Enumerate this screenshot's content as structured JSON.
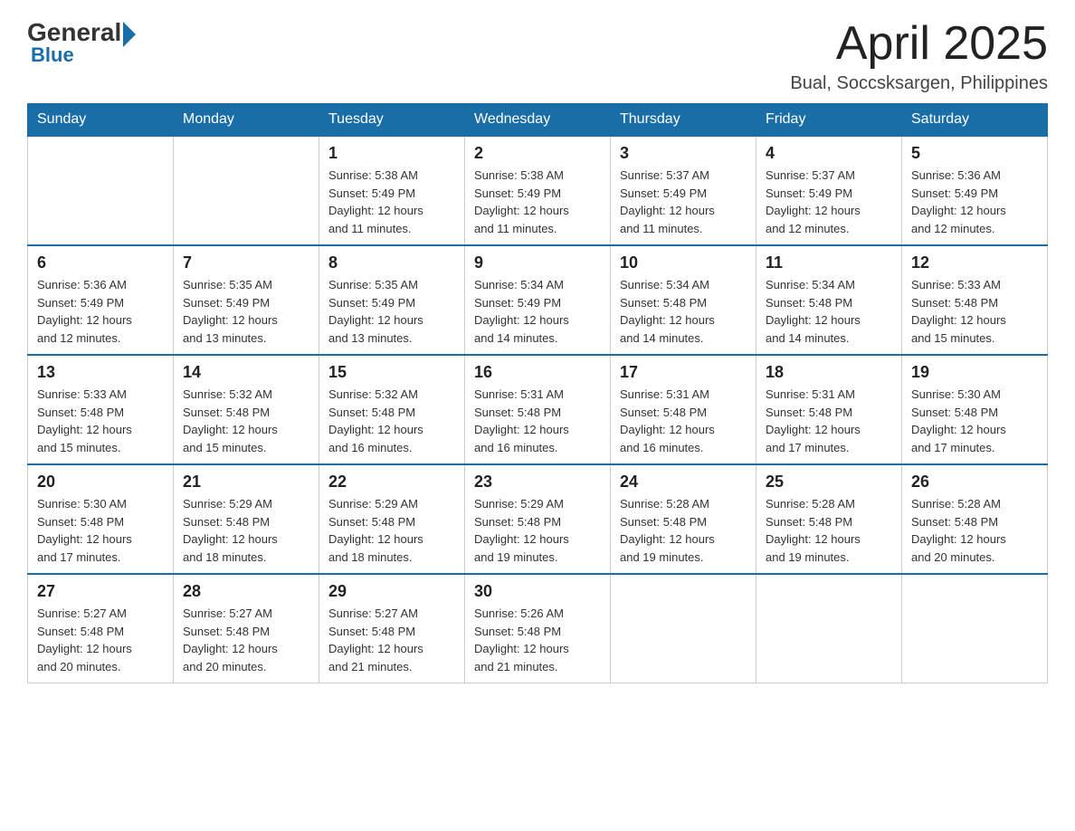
{
  "header": {
    "logo_general": "General",
    "logo_blue": "Blue",
    "month_title": "April 2025",
    "location": "Bual, Soccsksargen, Philippines"
  },
  "days_of_week": [
    "Sunday",
    "Monday",
    "Tuesday",
    "Wednesday",
    "Thursday",
    "Friday",
    "Saturday"
  ],
  "weeks": [
    [
      {
        "day": "",
        "info": ""
      },
      {
        "day": "",
        "info": ""
      },
      {
        "day": "1",
        "info": "Sunrise: 5:38 AM\nSunset: 5:49 PM\nDaylight: 12 hours\nand 11 minutes."
      },
      {
        "day": "2",
        "info": "Sunrise: 5:38 AM\nSunset: 5:49 PM\nDaylight: 12 hours\nand 11 minutes."
      },
      {
        "day": "3",
        "info": "Sunrise: 5:37 AM\nSunset: 5:49 PM\nDaylight: 12 hours\nand 11 minutes."
      },
      {
        "day": "4",
        "info": "Sunrise: 5:37 AM\nSunset: 5:49 PM\nDaylight: 12 hours\nand 12 minutes."
      },
      {
        "day": "5",
        "info": "Sunrise: 5:36 AM\nSunset: 5:49 PM\nDaylight: 12 hours\nand 12 minutes."
      }
    ],
    [
      {
        "day": "6",
        "info": "Sunrise: 5:36 AM\nSunset: 5:49 PM\nDaylight: 12 hours\nand 12 minutes."
      },
      {
        "day": "7",
        "info": "Sunrise: 5:35 AM\nSunset: 5:49 PM\nDaylight: 12 hours\nand 13 minutes."
      },
      {
        "day": "8",
        "info": "Sunrise: 5:35 AM\nSunset: 5:49 PM\nDaylight: 12 hours\nand 13 minutes."
      },
      {
        "day": "9",
        "info": "Sunrise: 5:34 AM\nSunset: 5:49 PM\nDaylight: 12 hours\nand 14 minutes."
      },
      {
        "day": "10",
        "info": "Sunrise: 5:34 AM\nSunset: 5:48 PM\nDaylight: 12 hours\nand 14 minutes."
      },
      {
        "day": "11",
        "info": "Sunrise: 5:34 AM\nSunset: 5:48 PM\nDaylight: 12 hours\nand 14 minutes."
      },
      {
        "day": "12",
        "info": "Sunrise: 5:33 AM\nSunset: 5:48 PM\nDaylight: 12 hours\nand 15 minutes."
      }
    ],
    [
      {
        "day": "13",
        "info": "Sunrise: 5:33 AM\nSunset: 5:48 PM\nDaylight: 12 hours\nand 15 minutes."
      },
      {
        "day": "14",
        "info": "Sunrise: 5:32 AM\nSunset: 5:48 PM\nDaylight: 12 hours\nand 15 minutes."
      },
      {
        "day": "15",
        "info": "Sunrise: 5:32 AM\nSunset: 5:48 PM\nDaylight: 12 hours\nand 16 minutes."
      },
      {
        "day": "16",
        "info": "Sunrise: 5:31 AM\nSunset: 5:48 PM\nDaylight: 12 hours\nand 16 minutes."
      },
      {
        "day": "17",
        "info": "Sunrise: 5:31 AM\nSunset: 5:48 PM\nDaylight: 12 hours\nand 16 minutes."
      },
      {
        "day": "18",
        "info": "Sunrise: 5:31 AM\nSunset: 5:48 PM\nDaylight: 12 hours\nand 17 minutes."
      },
      {
        "day": "19",
        "info": "Sunrise: 5:30 AM\nSunset: 5:48 PM\nDaylight: 12 hours\nand 17 minutes."
      }
    ],
    [
      {
        "day": "20",
        "info": "Sunrise: 5:30 AM\nSunset: 5:48 PM\nDaylight: 12 hours\nand 17 minutes."
      },
      {
        "day": "21",
        "info": "Sunrise: 5:29 AM\nSunset: 5:48 PM\nDaylight: 12 hours\nand 18 minutes."
      },
      {
        "day": "22",
        "info": "Sunrise: 5:29 AM\nSunset: 5:48 PM\nDaylight: 12 hours\nand 18 minutes."
      },
      {
        "day": "23",
        "info": "Sunrise: 5:29 AM\nSunset: 5:48 PM\nDaylight: 12 hours\nand 19 minutes."
      },
      {
        "day": "24",
        "info": "Sunrise: 5:28 AM\nSunset: 5:48 PM\nDaylight: 12 hours\nand 19 minutes."
      },
      {
        "day": "25",
        "info": "Sunrise: 5:28 AM\nSunset: 5:48 PM\nDaylight: 12 hours\nand 19 minutes."
      },
      {
        "day": "26",
        "info": "Sunrise: 5:28 AM\nSunset: 5:48 PM\nDaylight: 12 hours\nand 20 minutes."
      }
    ],
    [
      {
        "day": "27",
        "info": "Sunrise: 5:27 AM\nSunset: 5:48 PM\nDaylight: 12 hours\nand 20 minutes."
      },
      {
        "day": "28",
        "info": "Sunrise: 5:27 AM\nSunset: 5:48 PM\nDaylight: 12 hours\nand 20 minutes."
      },
      {
        "day": "29",
        "info": "Sunrise: 5:27 AM\nSunset: 5:48 PM\nDaylight: 12 hours\nand 21 minutes."
      },
      {
        "day": "30",
        "info": "Sunrise: 5:26 AM\nSunset: 5:48 PM\nDaylight: 12 hours\nand 21 minutes."
      },
      {
        "day": "",
        "info": ""
      },
      {
        "day": "",
        "info": ""
      },
      {
        "day": "",
        "info": ""
      }
    ]
  ]
}
